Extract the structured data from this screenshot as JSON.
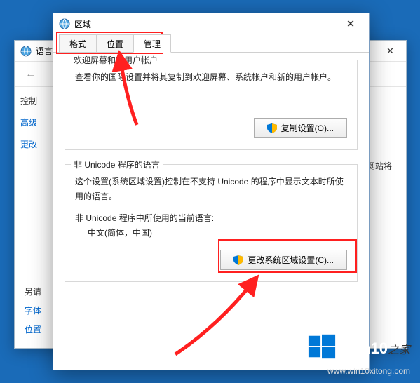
{
  "bgwin": {
    "title": "语言",
    "controls": {
      "min": "—",
      "max": "□",
      "close": "✕"
    },
    "nav_back": "←",
    "nav_fwd": "→",
    "nav_up": "↑",
    "sidebar": [
      "控制",
      "高级",
      "更改"
    ],
    "right_text": "和网站将",
    "bottom_label": "另请",
    "bottom_links": [
      "字体",
      "位置"
    ]
  },
  "dialog": {
    "title": "区域",
    "close": "✕",
    "tabs": [
      "格式",
      "位置",
      "管理"
    ],
    "group1": {
      "title": "欢迎屏幕和新用户帐户",
      "text": "查看你的国际设置并将其复制到欢迎屏幕、系统帐户和新的用户帐户。",
      "button": "复制设置(O)..."
    },
    "group2": {
      "title": "非 Unicode 程序的语言",
      "text": "这个设置(系统区域设置)控制在不支持 Unicode 的程序中显示文本时所使用的语言。",
      "current_label": "非 Unicode 程序中所使用的当前语言:",
      "current_value": "中文(简体，中国)",
      "button": "更改系统区域设置(C)..."
    }
  },
  "watermark": {
    "title": "Win10",
    "sub": "之家",
    "url": "www.win10xitong.com"
  }
}
